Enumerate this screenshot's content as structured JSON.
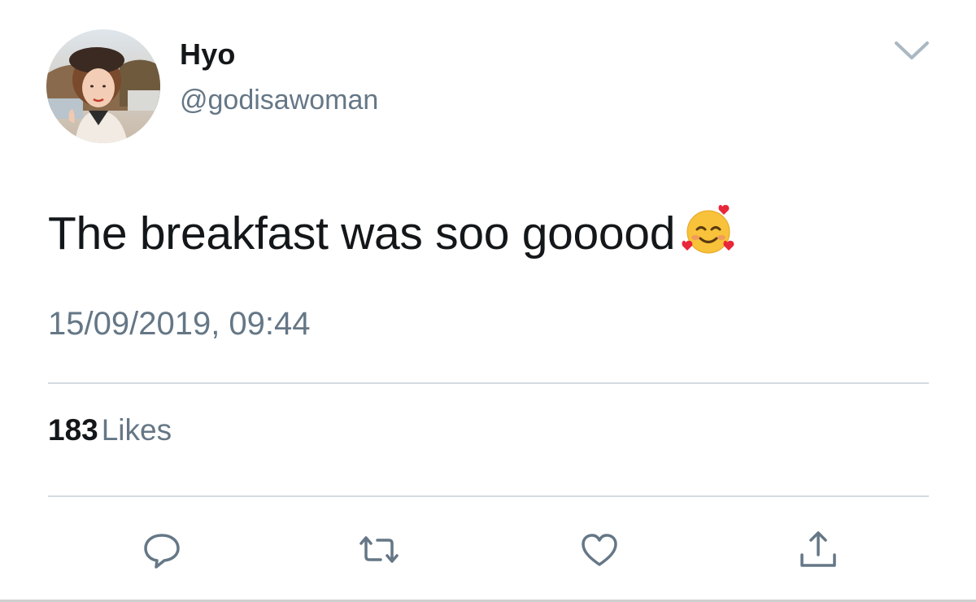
{
  "user": {
    "display_name": "Hyo",
    "handle": "@godisawoman"
  },
  "tweet": {
    "text": "The breakfast was soo gooood",
    "emoji": "smiling-face-with-hearts",
    "timestamp": "15/09/2019, 09:44"
  },
  "stats": {
    "likes_count": "183",
    "likes_label": "Likes"
  },
  "actions": [
    "reply-icon",
    "retweet-icon",
    "like-icon",
    "share-icon"
  ],
  "colors": {
    "primary_text": "#14171a",
    "secondary_text": "#657786",
    "divider": "#d4dbe0",
    "icon": "#657786"
  }
}
